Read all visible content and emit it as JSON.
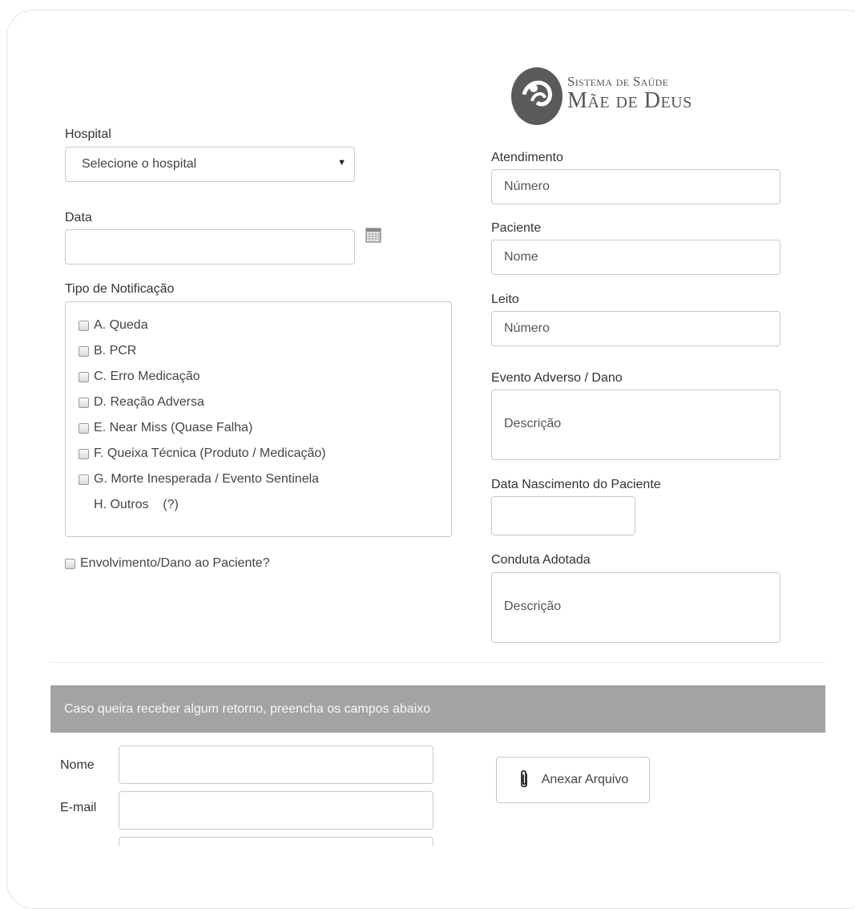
{
  "logo": {
    "line1": "Sistema de Saúde",
    "line2": "Mãe de Deus"
  },
  "left": {
    "hospital_label": "Hospital",
    "hospital_select": "Selecione o hospital",
    "data_label": "Data",
    "tipo_label": "Tipo de Notificação",
    "options": [
      "A. Queda",
      "B. PCR",
      "C. Erro Medicação",
      "D. Reação Adversa",
      "E. Near Miss (Quase Falha)",
      "F. Queixa Técnica (Produto / Medicação)",
      "G. Morte Inesperada / Evento Sentinela",
      "H. Outros    (?)"
    ],
    "envolvimento_label": "Envolvimento/Dano ao Paciente?"
  },
  "right": {
    "atendimento_label": "Atendimento",
    "atendimento_placeholder": "Número",
    "paciente_label": "Paciente",
    "paciente_placeholder": "Nome",
    "leito_label": "Leito",
    "leito_placeholder": "Número",
    "evento_label": "Evento Adverso / Dano",
    "evento_placeholder": "Descrição",
    "nascimento_label": "Data Nascimento do Paciente",
    "conduta_label": "Conduta Adotada",
    "conduta_placeholder": "Descrição"
  },
  "contact": {
    "banner_text": "Caso queira receber algum retorno, preencha os campos abaixo",
    "nome_label": "Nome",
    "email_label": "E-mail",
    "attach_label": "Anexar Arquivo"
  },
  "colors": {
    "banner_bg": "#a3a3a3",
    "border": "#c9c9c9",
    "logo_gray": "#5a5a5a"
  }
}
